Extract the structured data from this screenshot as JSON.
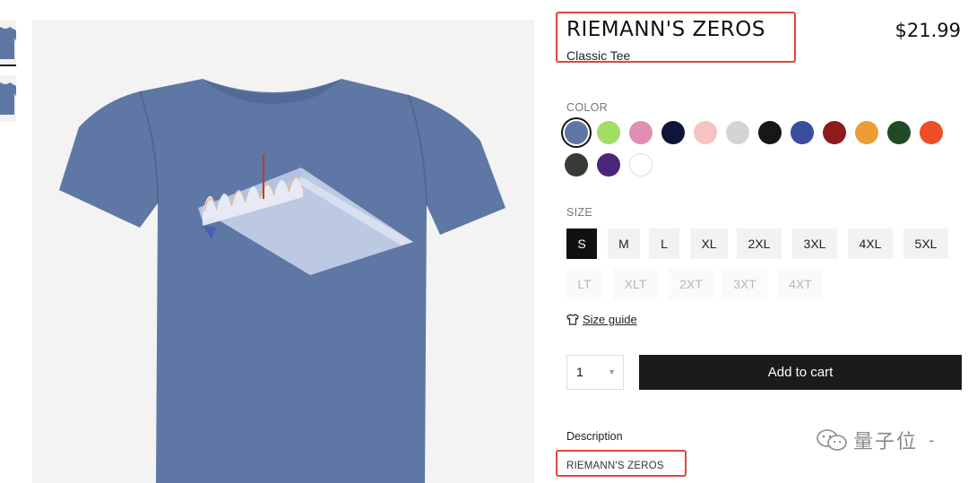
{
  "product": {
    "title": "RIEMANN'S ZEROS",
    "subtitle": "Classic Tee",
    "price": "$21.99",
    "shirt_color": "#5f77a4",
    "accent_red": "#e0453d"
  },
  "color": {
    "label": "COLOR",
    "swatches": [
      {
        "name": "heather blue",
        "hex": "#5f77a4",
        "selected": true
      },
      {
        "name": "lime",
        "hex": "#a2dd65"
      },
      {
        "name": "pink",
        "hex": "#e08eb3"
      },
      {
        "name": "navy",
        "hex": "#0e1539"
      },
      {
        "name": "light pink",
        "hex": "#f5c3c2"
      },
      {
        "name": "light gray",
        "hex": "#d4d4d4"
      },
      {
        "name": "black",
        "hex": "#171717"
      },
      {
        "name": "royal blue",
        "hex": "#3a4da0"
      },
      {
        "name": "maroon",
        "hex": "#8d1a1f"
      },
      {
        "name": "gold",
        "hex": "#ee9c36"
      },
      {
        "name": "forest green",
        "hex": "#1f4a23"
      },
      {
        "name": "orange",
        "hex": "#ef4d25"
      },
      {
        "name": "charcoal",
        "hex": "#363b36"
      },
      {
        "name": "purple",
        "hex": "#4a2779"
      },
      {
        "name": "white",
        "hex": "#ffffff"
      }
    ]
  },
  "size": {
    "label": "SIZE",
    "options": [
      {
        "label": "S",
        "selected": true
      },
      {
        "label": "M"
      },
      {
        "label": "L"
      },
      {
        "label": "XL"
      },
      {
        "label": "2XL"
      },
      {
        "label": "3XL"
      },
      {
        "label": "4XL"
      },
      {
        "label": "5XL"
      },
      {
        "label": "LT",
        "disabled": true
      },
      {
        "label": "XLT",
        "disabled": true
      },
      {
        "label": "2XT",
        "disabled": true
      },
      {
        "label": "3XT",
        "disabled": true
      },
      {
        "label": "4XT",
        "disabled": true
      }
    ],
    "guide_label": "Size guide"
  },
  "cart": {
    "quantity": "1",
    "add_label": "Add to cart"
  },
  "description": {
    "label": "Description",
    "text": "RIEMANN'S ZEROS"
  },
  "watermark": {
    "text": "量子位",
    "dash": "-"
  }
}
